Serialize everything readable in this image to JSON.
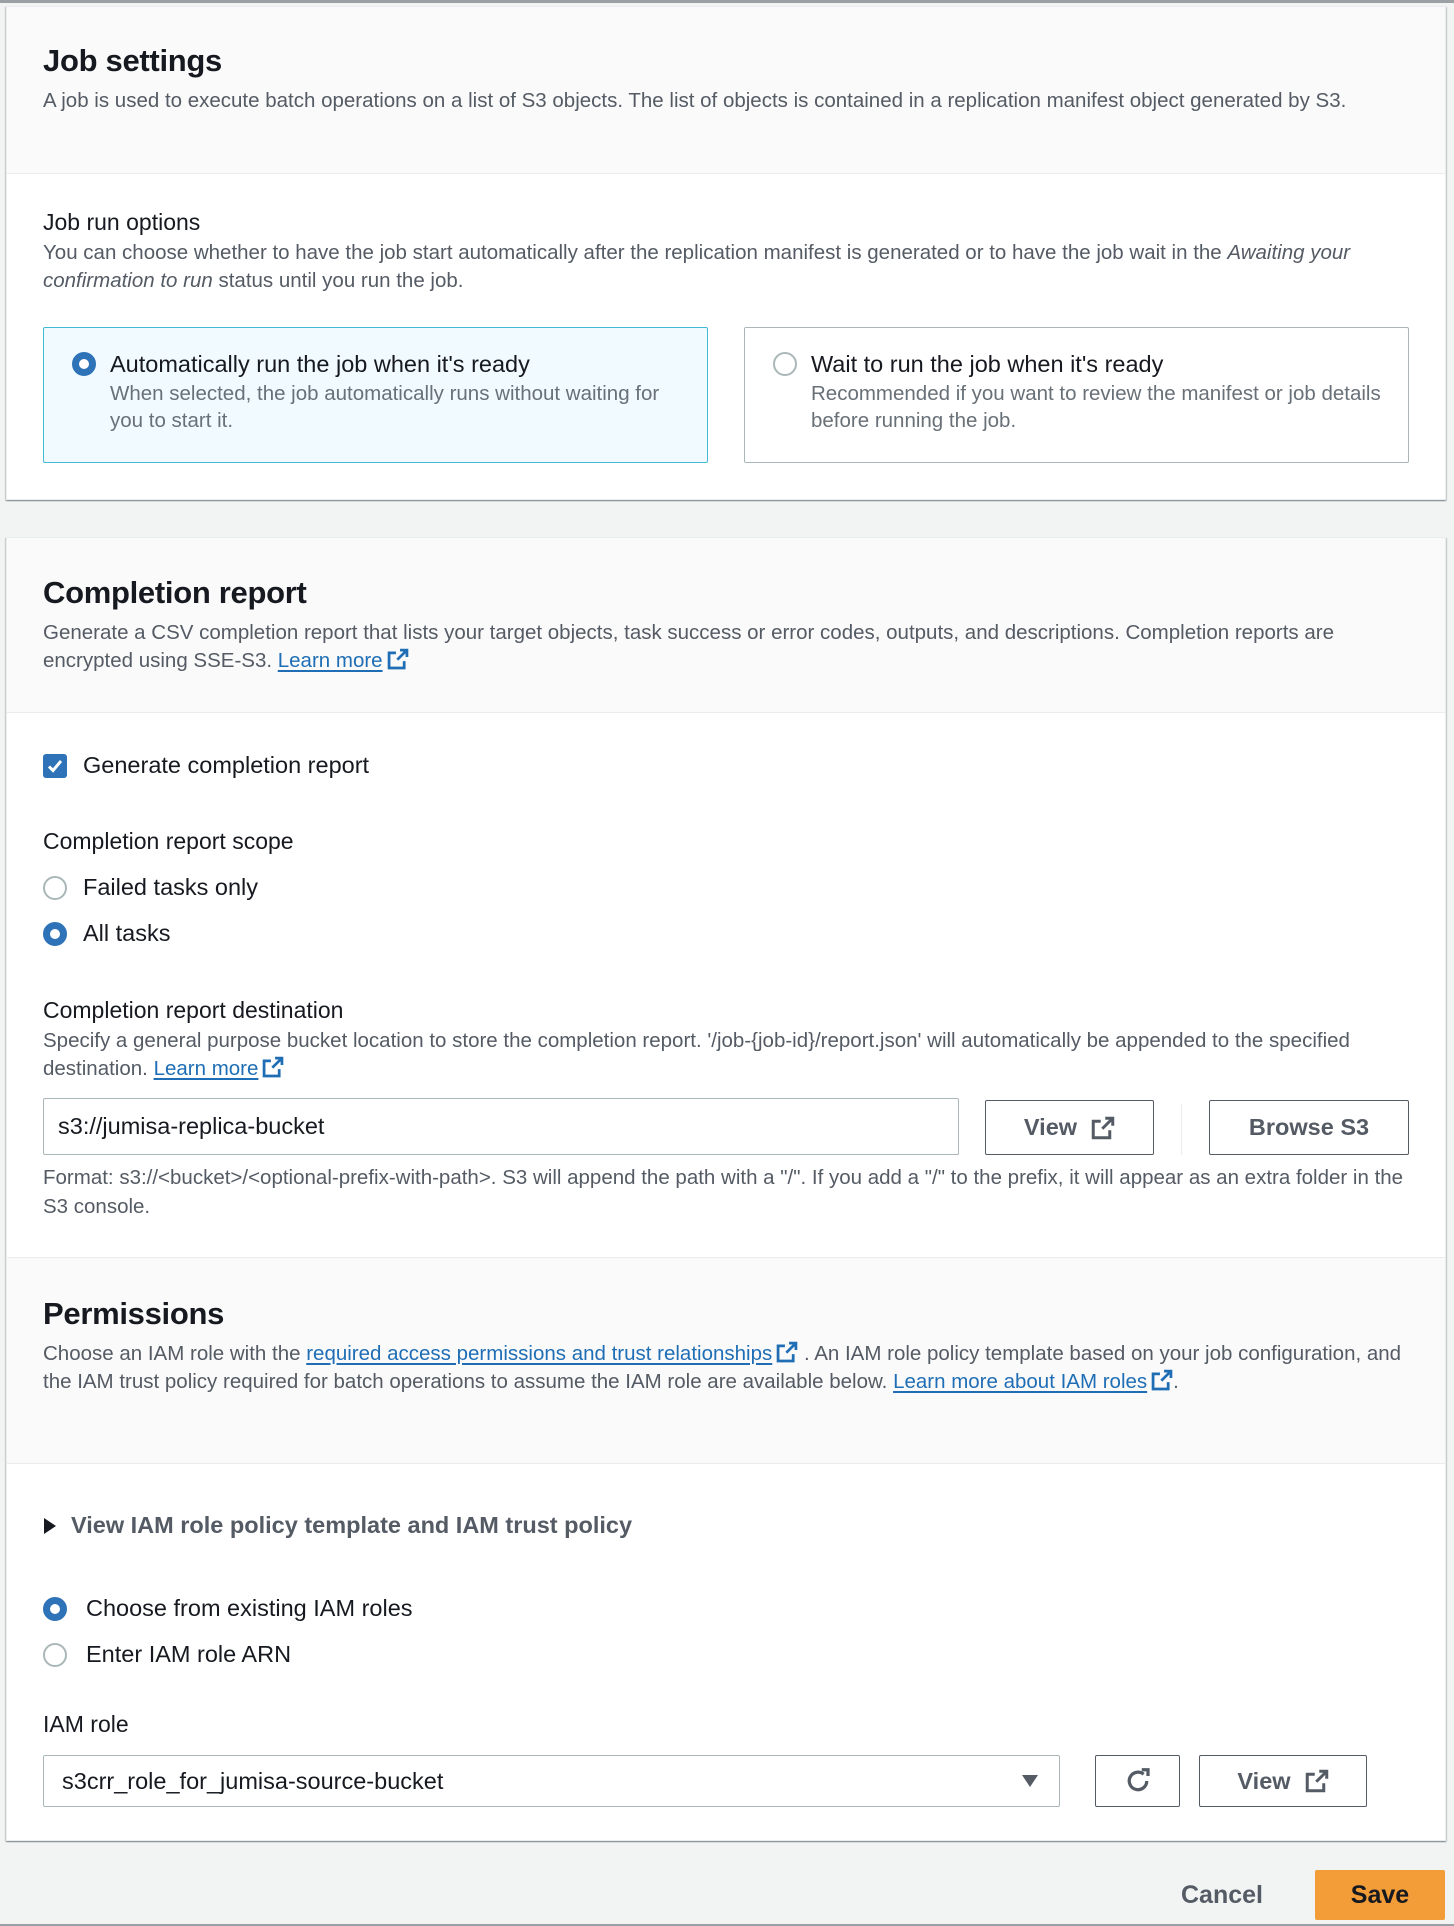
{
  "job_settings": {
    "title": "Job settings",
    "description": "A job is used to execute batch operations on a list of S3 objects. The list of objects is contained in a replication manifest object generated by S3.",
    "run_options": {
      "label": "Job run options",
      "description_prefix": "You can choose whether to have the job start automatically after the replication manifest is generated or to have the job wait in the ",
      "description_italic": "Awaiting your confirmation to run",
      "description_suffix": " status until you run the job.",
      "options": [
        {
          "label": "Automatically run the job when it's ready",
          "description": "When selected, the job automatically runs without waiting for you to start it.",
          "selected": true
        },
        {
          "label": "Wait to run the job when it's ready",
          "description": "Recommended if you want to review the manifest or job details before running the job.",
          "selected": false
        }
      ]
    }
  },
  "completion_report": {
    "title": "Completion report",
    "description": "Generate a CSV completion report that lists your target objects, task success or error codes, outputs, and descriptions. Completion reports are encrypted using SSE-S3. ",
    "learn_more": "Learn more",
    "generate_checkbox": {
      "label": "Generate completion report",
      "checked": true
    },
    "scope": {
      "label": "Completion report scope",
      "options": [
        {
          "label": "Failed tasks only",
          "selected": false
        },
        {
          "label": "All tasks",
          "selected": true
        }
      ]
    },
    "destination": {
      "label": "Completion report destination",
      "description": "Specify a general purpose bucket location to store the completion report. '/job-{job-id}/report.json' will automatically be appended to the specified destination. ",
      "learn_more": "Learn more",
      "value": "s3://jumisa-replica-bucket",
      "view_button": "View",
      "browse_button": "Browse S3",
      "hint": "Format: s3://<bucket>/<optional-prefix-with-path>. S3 will append the path with a \"/\". If you add a \"/\" to the prefix, it will appear as an extra folder in the S3 console."
    }
  },
  "permissions": {
    "title": "Permissions",
    "desc_prefix": "Choose an IAM role with the ",
    "desc_link1": "required access permissions and trust relationships",
    "desc_middle": " . An IAM role policy template based on your job configuration, and the IAM trust policy required for batch operations to assume the IAM role are available below. ",
    "desc_link2": "Learn more about IAM roles",
    "desc_suffix": ".",
    "expander_label": "View IAM role policy template and IAM trust policy",
    "role_source": [
      {
        "label": "Choose from existing IAM roles",
        "selected": true
      },
      {
        "label": "Enter IAM role ARN",
        "selected": false
      }
    ],
    "iam_role": {
      "label": "IAM role",
      "value": "s3crr_role_for_jumisa-source-bucket",
      "view_button": "View"
    }
  },
  "footer": {
    "cancel": "Cancel",
    "save": "Save"
  },
  "colors": {
    "primary_blue": "#2e73b8",
    "link": "#1f6eb5",
    "save_orange": "#f29d38",
    "selected_tile_bg": "#f1faff"
  }
}
